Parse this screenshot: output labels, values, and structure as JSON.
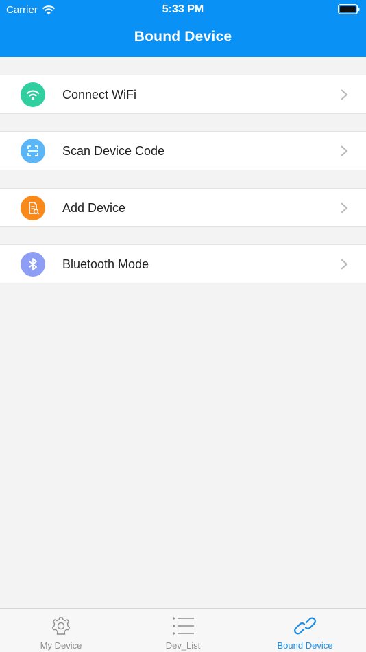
{
  "status_bar": {
    "carrier": "Carrier",
    "time": "5:33 PM"
  },
  "header": {
    "title": "Bound Device",
    "color": "#0a91f5"
  },
  "menu": {
    "items": [
      {
        "label": "Connect WiFi",
        "icon": "wifi-icon",
        "icon_color": "#2fcf9f"
      },
      {
        "label": "Scan Device Code",
        "icon": "scan-icon",
        "icon_color": "#5bb6f8"
      },
      {
        "label": "Add Device",
        "icon": "document-icon",
        "icon_color": "#f98a1a"
      },
      {
        "label": "Bluetooth Mode",
        "icon": "bluetooth-icon",
        "icon_color": "#8f9ef5"
      }
    ]
  },
  "tabbar": {
    "tabs": [
      {
        "label": "My Device",
        "icon": "gear-icon",
        "active": false
      },
      {
        "label": "Dev_List",
        "icon": "list-icon",
        "active": false
      },
      {
        "label": "Bound Device",
        "icon": "link-icon",
        "active": true
      }
    ],
    "active_color": "#1b8fe6",
    "inactive_color": "#8e8e8e"
  }
}
